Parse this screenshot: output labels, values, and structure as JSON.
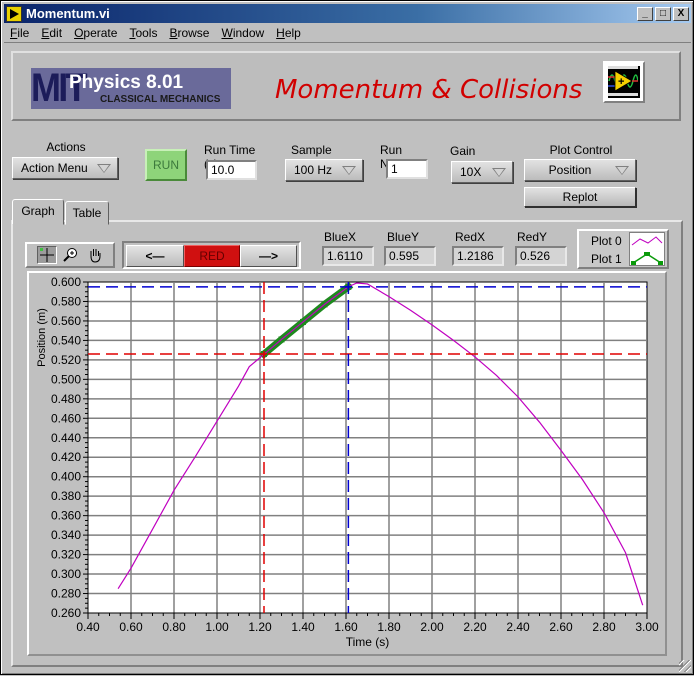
{
  "window": {
    "title": "Momentum.vi",
    "controls": [
      "_",
      "□",
      "X"
    ]
  },
  "menu": [
    {
      "label": "File",
      "mnemonic": "F",
      "rest": "ile"
    },
    {
      "label": "Edit",
      "mnemonic": "E",
      "rest": "dit"
    },
    {
      "label": "Operate",
      "mnemonic": "O",
      "rest": "perate"
    },
    {
      "label": "Tools",
      "mnemonic": "T",
      "rest": "ools"
    },
    {
      "label": "Browse",
      "mnemonic": "B",
      "rest": "rowse"
    },
    {
      "label": "Window",
      "mnemonic": "W",
      "rest": "indow"
    },
    {
      "label": "Help",
      "mnemonic": "H",
      "rest": "elp"
    }
  ],
  "banner": {
    "logo_mit": "MIT",
    "logo_title": "Physics 8.01",
    "logo_subtitle": "CLASSICAL MECHANICS",
    "title": "Momentum & Collisions",
    "vi_icon": "labview-vi-icon"
  },
  "controls": {
    "actions_label": "Actions",
    "actions_value": "Action Menu",
    "run_label": "RUN",
    "run_time_label": "Run Time (s)",
    "run_time_value": "10.0",
    "sample_rate_label": "Sample Rate",
    "sample_rate_value": "100 Hz",
    "run_number_label": "Run Number",
    "run_number_value": "1",
    "gain_label": "Gain",
    "gain_value": "10X",
    "plot_control_label": "Plot Control",
    "plot_control_value": "Position",
    "replot_label": "Replot"
  },
  "tabs": [
    {
      "label": "Graph",
      "active": true
    },
    {
      "label": "Table",
      "active": false
    }
  ],
  "graph_toolbar": {
    "tools": [
      "cursor-crosshair-icon",
      "zoom-icon",
      "pan-hand-icon"
    ],
    "prev_label": "<—",
    "cursor_select_label": "RED",
    "next_label": "—>"
  },
  "readouts": {
    "bluex_label": "BlueX",
    "bluex_value": "1.6110",
    "bluey_label": "BlueY",
    "bluey_value": "0.595",
    "redx_label": "RedX",
    "redx_value": "1.2186",
    "redy_label": "RedY",
    "redy_value": "0.526"
  },
  "legend": [
    {
      "label": "Plot 0",
      "color": "#c000c0"
    },
    {
      "label": "Plot 1",
      "color": "#0a9a0a"
    }
  ],
  "colors": {
    "plot0": "#c000c0",
    "plot1": "#1e8a1e",
    "red_cursor": "#e00000",
    "blue_cursor": "#0000d0",
    "grid": "#808080",
    "title_red": "#d10000",
    "run_green": "#8ed47a",
    "red_button": "#d01010"
  },
  "chart_data": {
    "type": "line",
    "title": "",
    "xlabel": "Time (s)",
    "ylabel": "Position (m)",
    "xlim": [
      0.4,
      3.0
    ],
    "ylim": [
      0.26,
      0.6
    ],
    "x_ticks": [
      "0.40",
      "0.60",
      "0.80",
      "1.00",
      "1.20",
      "1.40",
      "1.60",
      "1.80",
      "2.00",
      "2.20",
      "2.40",
      "2.60",
      "2.80",
      "3.00"
    ],
    "y_ticks": [
      "0.260",
      "0.280",
      "0.300",
      "0.320",
      "0.340",
      "0.360",
      "0.380",
      "0.400",
      "0.420",
      "0.440",
      "0.460",
      "0.480",
      "0.500",
      "0.520",
      "0.540",
      "0.560",
      "0.580",
      "0.600"
    ],
    "grid": true,
    "legend_position": "top-right",
    "series": [
      {
        "name": "Plot 0",
        "color": "#c000c0",
        "x": [
          0.54,
          0.6,
          0.7,
          0.8,
          0.9,
          1.0,
          1.1,
          1.15,
          1.22,
          1.3,
          1.4,
          1.5,
          1.61,
          1.65,
          1.7,
          1.8,
          1.9,
          2.0,
          2.1,
          2.2,
          2.3,
          2.4,
          2.5,
          2.6,
          2.7,
          2.8,
          2.9,
          2.98
        ],
        "y": [
          0.285,
          0.306,
          0.346,
          0.386,
          0.421,
          0.457,
          0.493,
          0.513,
          0.526,
          0.541,
          0.559,
          0.577,
          0.595,
          0.599,
          0.598,
          0.585,
          0.571,
          0.556,
          0.54,
          0.523,
          0.504,
          0.482,
          0.456,
          0.427,
          0.397,
          0.363,
          0.322,
          0.268
        ]
      },
      {
        "name": "Plot 1",
        "color": "#1e8a1e",
        "x": [
          1.2186,
          1.3,
          1.4,
          1.5,
          1.611
        ],
        "y": [
          0.526,
          0.541,
          0.559,
          0.577,
          0.595
        ]
      }
    ],
    "cursors": [
      {
        "name": "Red",
        "x": 1.2186,
        "y": 0.526,
        "color": "#e00000"
      },
      {
        "name": "Blue",
        "x": 1.611,
        "y": 0.595,
        "color": "#0000d0"
      }
    ]
  }
}
